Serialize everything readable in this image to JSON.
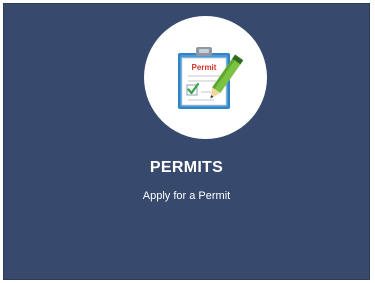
{
  "card": {
    "title": "PERMITS",
    "subtitle": "Apply for a Permit",
    "icon": "permit-clipboard-pencil-icon",
    "icon_label": "Permit"
  },
  "colors": {
    "card_background": "#374a6d",
    "icon_circle": "#ffffff",
    "text": "#ffffff",
    "permit_label": "#d9352b",
    "check": "#3aa24a",
    "pencil": "#7cc242"
  }
}
